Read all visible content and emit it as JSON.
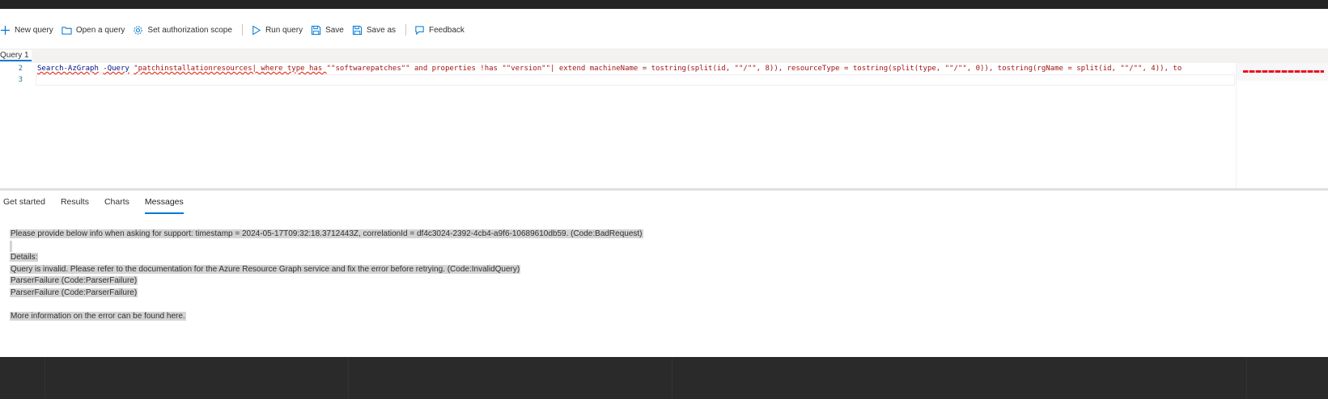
{
  "toolbar": {
    "new_query": "New query",
    "open_query": "Open a query",
    "auth_scope": "Set authorization scope",
    "run_query": "Run query",
    "save": "Save",
    "save_as": "Save as",
    "feedback": "Feedback"
  },
  "query_tab": {
    "label": "Query 1"
  },
  "editor": {
    "line_numbers": [
      "2",
      "3"
    ],
    "line2": {
      "cmd1": "Search-AzGraph",
      "space1": " ",
      "cmd2": "-Query",
      "space2": " ",
      "err": "\"patchinstallationresources| where type has ",
      "rest": "\"\"softwarepatches\"\" and properties !has \"\"version\"\"| extend machineName = tostring(split(id, \"\"/\"\", 8)), resourceType = tostring(split(type, \"\"/\"\", 0)), tostring(rgName = split(id, \"\"/\"\", 4)), to"
    }
  },
  "result_tabs": [
    "Get started",
    "Results",
    "Charts",
    "Messages"
  ],
  "active_result_tab": "Messages",
  "messages": {
    "support": "Please provide below info when asking for support: timestamp = 2024-05-17T09:32:18.3712443Z, correlationId = df4c3024-2392-4cb4-a9f6-10689610db59. (Code:BadRequest)",
    "details": "Details:",
    "invalid": "Query is invalid. Please refer to the documentation for the Azure Resource Graph service and fix the error before retrying. (Code:InvalidQuery)",
    "parser1": "ParserFailure (Code:ParserFailure)",
    "parser2": "ParserFailure (Code:ParserFailure)",
    "more_info": "More information on the error can be found here."
  },
  "colors": {
    "accent": "#0078d4",
    "error": "#e51400"
  }
}
